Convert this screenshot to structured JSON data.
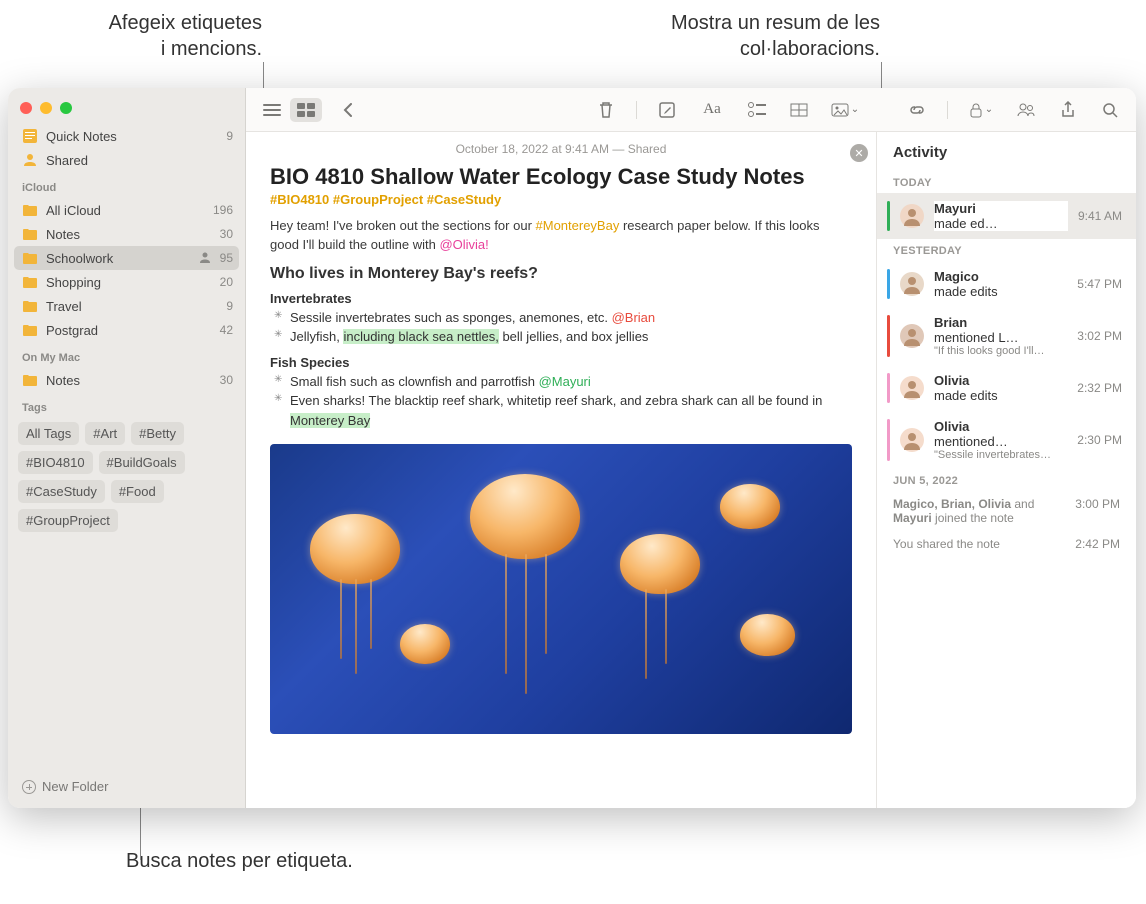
{
  "callouts": {
    "top_left": "Afegeix etiquetes\ni mencions.",
    "top_right": "Mostra un resum de les\ncol·laboracions.",
    "bottom": "Busca notes per etiqueta."
  },
  "sidebar": {
    "quick_notes": {
      "label": "Quick Notes",
      "count": "9"
    },
    "shared": {
      "label": "Shared"
    },
    "sections": [
      {
        "header": "iCloud",
        "items": [
          {
            "label": "All iCloud",
            "count": "196"
          },
          {
            "label": "Notes",
            "count": "30"
          },
          {
            "label": "Schoolwork",
            "count": "95",
            "selected": true,
            "shared": true
          },
          {
            "label": "Shopping",
            "count": "20"
          },
          {
            "label": "Travel",
            "count": "9"
          },
          {
            "label": "Postgrad",
            "count": "42"
          }
        ]
      },
      {
        "header": "On My Mac",
        "items": [
          {
            "label": "Notes",
            "count": "30"
          }
        ]
      }
    ],
    "tags_header": "Tags",
    "tags": [
      "All Tags",
      "#Art",
      "#Betty",
      "#BIO4810",
      "#BuildGoals",
      "#CaseStudy",
      "#Food",
      "#GroupProject"
    ],
    "new_folder": "New Folder"
  },
  "note": {
    "timestamp": "October 18, 2022 at 9:41 AM — Shared",
    "title": "BIO 4810 Shallow Water Ecology Case Study Notes",
    "tags": "#BIO4810 #GroupProject #CaseStudy",
    "intro_pre": "Hey team! I've broken out the sections for our ",
    "intro_tag": "#MontereyBay",
    "intro_mid": " research paper below. If this looks good I'll build the outline with ",
    "intro_mention": "@Olivia!",
    "h2": "Who lives in Monterey Bay's reefs?",
    "invert_h": "Invertebrates",
    "invert_1_pre": "Sessile invertebrates such as sponges, anemones, etc. ",
    "invert_1_mention": "@Brian",
    "invert_2_pre": "Jellyfish, ",
    "invert_2_hl": "including black sea nettles,",
    "invert_2_post": " bell jellies, and box jellies",
    "fish_h": "Fish Species",
    "fish_1_pre": "Small fish such as clownfish and parrotfish ",
    "fish_1_mention": "@Mayuri",
    "fish_2_pre": "Even sharks! The blacktip reef shark, whitetip reef shark, and zebra shark can all be found in ",
    "fish_2_hl": "Monterey Bay"
  },
  "activity": {
    "title": "Activity",
    "today_h": "TODAY",
    "today": [
      {
        "bar": "#2fae57",
        "avatar": "#f0d7c6",
        "name": "Mayuri",
        "text": "Mayuri made ed…",
        "time": "9:41 AM"
      }
    ],
    "yesterday_h": "YESTERDAY",
    "yesterday": [
      {
        "bar": "#3aa6e6",
        "avatar": "#e8d8c8",
        "text": "Magico made edits",
        "time": "5:47 PM"
      },
      {
        "bar": "#e84b3d",
        "avatar": "#e0c8b8",
        "text": "Brian mentioned L…",
        "sub": "\"If this looks good I'll…",
        "time": "3:02 PM"
      },
      {
        "bar": "#f29ac8",
        "avatar": "#f5dccc",
        "text": "Olivia made edits",
        "time": "2:32 PM"
      },
      {
        "bar": "#f29ac8",
        "avatar": "#f5dccc",
        "text": "Olivia mentioned…",
        "sub": "\"Sessile invertebrates…",
        "time": "2:30 PM"
      }
    ],
    "jun5_h": "JUN 5, 2022",
    "join1": "Magico, Brian, Olivia and Mayuri joined the note",
    "join1_t": "3:00 PM",
    "join2": "You shared the note",
    "join2_t": "2:42 PM"
  }
}
